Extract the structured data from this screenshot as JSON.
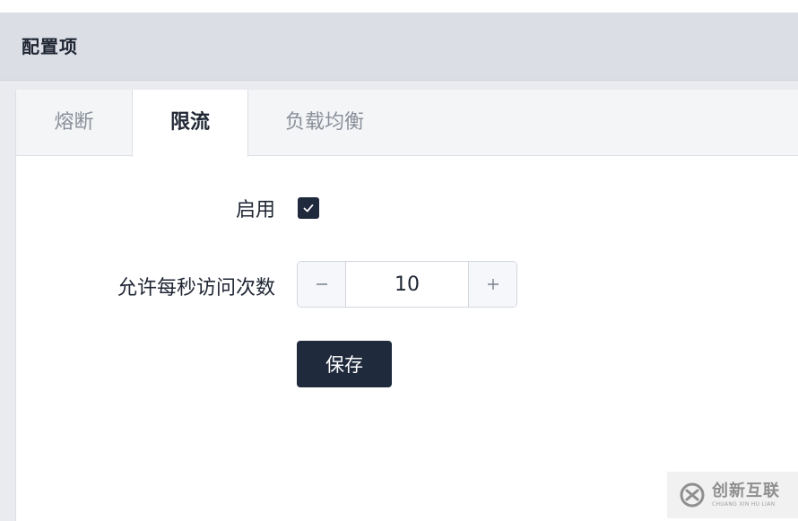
{
  "header": {
    "title": "配置项"
  },
  "tabs": [
    {
      "label": "熔断",
      "active": false
    },
    {
      "label": "限流",
      "active": true
    },
    {
      "label": "负载均衡",
      "active": false
    }
  ],
  "form": {
    "enable_label": "启用",
    "enable_checked": true,
    "rate_label": "允许每秒访问次数",
    "rate_value": "10",
    "minus_symbol": "−",
    "plus_symbol": "+",
    "save_label": "保存"
  },
  "watermark": {
    "logo": "创新互联",
    "sub": "CHUANG XIN HU LIAN"
  },
  "colors": {
    "primary": "#1f2a3c",
    "header_bg": "#dbdee5",
    "tab_bar_bg": "#f4f5f7",
    "border": "#dcdfe6"
  }
}
